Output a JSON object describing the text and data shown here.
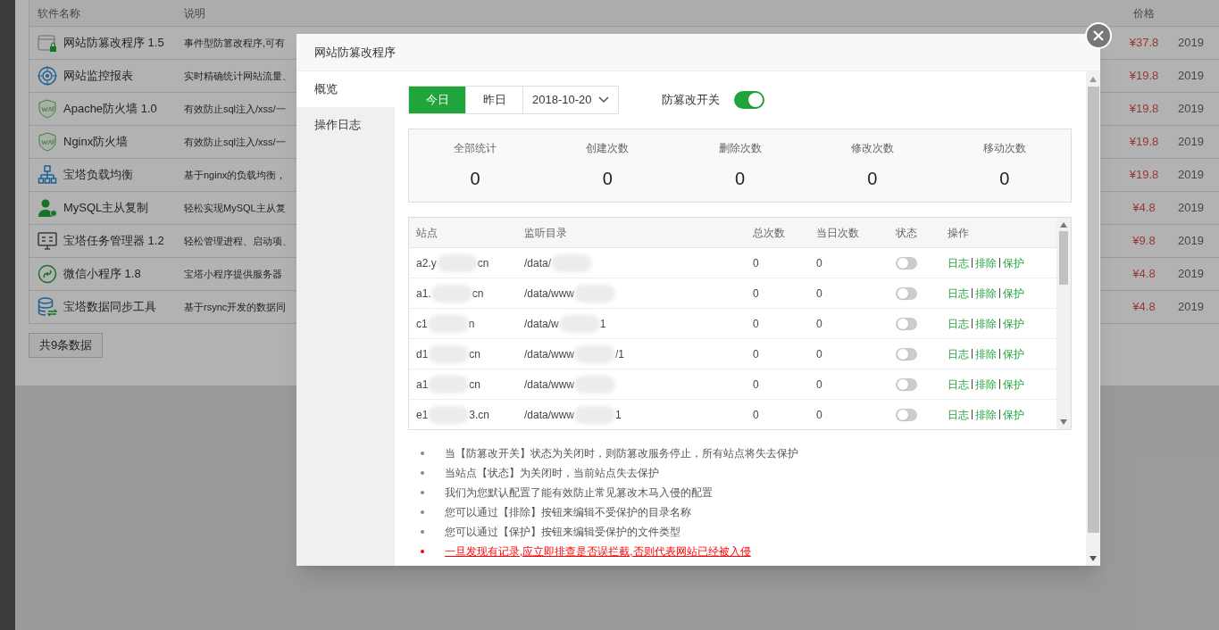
{
  "background_table": {
    "columns": [
      "软件名称",
      "说明",
      "价格"
    ],
    "rows": [
      {
        "kind": "window-lock",
        "name": "网站防篡改程序 1.5",
        "desc": "事件型防篡改程序,可有",
        "price": "¥37.8",
        "date": "2019"
      },
      {
        "kind": "target",
        "name": "网站监控报表",
        "desc": "实时精确统计网站流量、",
        "price": "¥19.8",
        "date": "2019"
      },
      {
        "kind": "shield",
        "name": "Apache防火墙 1.0",
        "desc": "有效防止sql注入/xss/一",
        "price": "¥19.8",
        "date": "2019"
      },
      {
        "kind": "shield",
        "name": "Nginx防火墙",
        "desc": "有效防止sql注入/xss/一",
        "price": "¥19.8",
        "date": "2019"
      },
      {
        "kind": "network",
        "name": "宝塔负载均衡",
        "desc": "基于nginx的负载均衡，",
        "price": "¥19.8",
        "date": "2019"
      },
      {
        "kind": "user",
        "name": "MySQL主从复制",
        "desc": "轻松实现MySQL主从复",
        "price": "¥4.8",
        "date": "2019"
      },
      {
        "kind": "monitor",
        "name": "宝塔任务管理器 1.2",
        "desc": "轻松管理进程、启动项、",
        "price": "¥9.8",
        "date": "2019"
      },
      {
        "kind": "link",
        "name": "微信小程序 1.8",
        "desc": "宝塔小程序提供服务器",
        "price": "¥4.8",
        "date": "2019"
      },
      {
        "kind": "database",
        "name": "宝塔数据同步工具",
        "desc": "基于rsync开发的数据同",
        "price": "¥4.8",
        "date": "2019"
      }
    ],
    "footer": "共9条数据"
  },
  "dialog": {
    "title": "网站防篡改程序",
    "sidebar": [
      {
        "label": "概览",
        "selected": true
      },
      {
        "label": "操作日志",
        "selected": false
      }
    ],
    "day_tabs": [
      {
        "label": "今日",
        "selected": true
      },
      {
        "label": "昨日",
        "selected": false
      }
    ],
    "date": "2018-10-20",
    "switch": {
      "label": "防篡改开关",
      "on": true
    },
    "stats": [
      {
        "label": "全部统计",
        "value": "0"
      },
      {
        "label": "创建次数",
        "value": "0"
      },
      {
        "label": "删除次数",
        "value": "0"
      },
      {
        "label": "修改次数",
        "value": "0"
      },
      {
        "label": "移动次数",
        "value": "0"
      }
    ],
    "table": {
      "columns": [
        "站点",
        "监听目录",
        "总次数",
        "当日次数",
        "状态",
        "操作"
      ],
      "rows": [
        {
          "site": "a2.y",
          "site_end": "cn",
          "dir": "/data/",
          "dir_end": "",
          "total": "0",
          "today": "0",
          "on": false,
          "actions": [
            "日志",
            "排除",
            "保护"
          ]
        },
        {
          "site": "a1.",
          "site_end": "cn",
          "dir": "/data/www",
          "dir_end": "",
          "total": "0",
          "today": "0",
          "on": false,
          "actions": [
            "日志",
            "排除",
            "保护"
          ]
        },
        {
          "site": "c1",
          "site_end": "n",
          "dir": "/data/w",
          "dir_end": "1",
          "total": "0",
          "today": "0",
          "on": false,
          "actions": [
            "日志",
            "排除",
            "保护"
          ]
        },
        {
          "site": "d1",
          "site_end": "cn",
          "dir": "/data/www",
          "dir_end": "/1",
          "total": "0",
          "today": "0",
          "on": false,
          "actions": [
            "日志",
            "排除",
            "保护"
          ]
        },
        {
          "site": "a1",
          "site_end": "cn",
          "dir": "/data/www",
          "dir_end": "",
          "total": "0",
          "today": "0",
          "on": false,
          "actions": [
            "日志",
            "排除",
            "保护"
          ]
        },
        {
          "site": "e1",
          "site_end": "3.cn",
          "dir": "/data/www",
          "dir_end": "1",
          "total": "0",
          "today": "0",
          "on": false,
          "actions": [
            "日志",
            "排除",
            "保护"
          ]
        }
      ]
    },
    "notes": [
      {
        "text": "当【防篡改开关】状态为关闭时，则防篡改服务停止，所有站点将失去保护",
        "warning": false
      },
      {
        "text": "当站点【状态】为关闭时，当前站点失去保护",
        "warning": false
      },
      {
        "text": "我们为您默认配置了能有效防止常见篡改木马入侵的配置",
        "warning": false
      },
      {
        "text": "您可以通过【排除】按钮来编辑不受保护的目录名称",
        "warning": false
      },
      {
        "text": "您可以通过【保护】按钮来编辑受保护的文件类型",
        "warning": false
      },
      {
        "text": "一旦发现有记录,应立即排查是否误拦截,否则代表网站已经被入侵",
        "warning": true
      }
    ]
  }
}
